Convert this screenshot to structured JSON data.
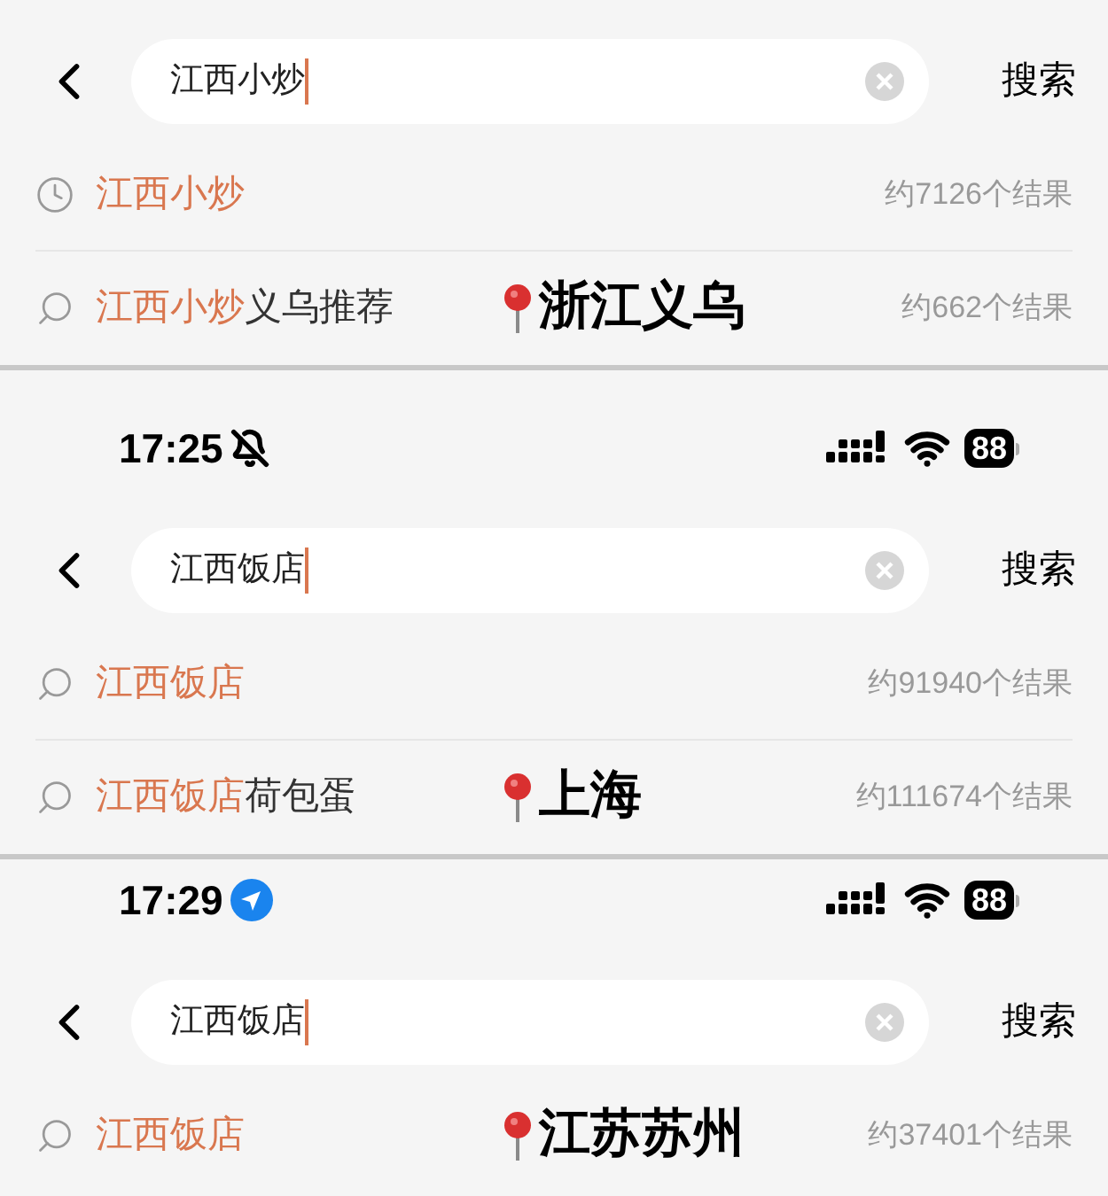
{
  "panels": [
    {
      "search": {
        "value": "江西小炒"
      },
      "search_button": "搜索",
      "suggestions": [
        {
          "kind": "history",
          "match": "江西小炒",
          "count": "约7126个结果"
        },
        {
          "kind": "search",
          "match": "江西小炒",
          "suffix": "义乌推荐",
          "count": "约662个结果",
          "annotation": "浙江义乌"
        }
      ]
    },
    {
      "status_bar": {
        "time": "17:25",
        "kind": "silent",
        "battery": "88"
      },
      "search": {
        "value": "江西饭店"
      },
      "search_button": "搜索",
      "suggestions": [
        {
          "kind": "search",
          "match": "江西饭店",
          "count": "约91940个结果"
        },
        {
          "kind": "search",
          "match": "江西饭店",
          "suffix": "荷包蛋",
          "count": "约111674个结果",
          "annotation": "上海"
        }
      ]
    },
    {
      "status_bar": {
        "time": "17:29",
        "kind": "location",
        "battery": "88"
      },
      "search": {
        "value": "江西饭店"
      },
      "search_button": "搜索",
      "suggestions": [
        {
          "kind": "search",
          "match": "江西饭店",
          "count": "约37401个结果",
          "annotation": "江苏苏州"
        }
      ]
    }
  ]
}
